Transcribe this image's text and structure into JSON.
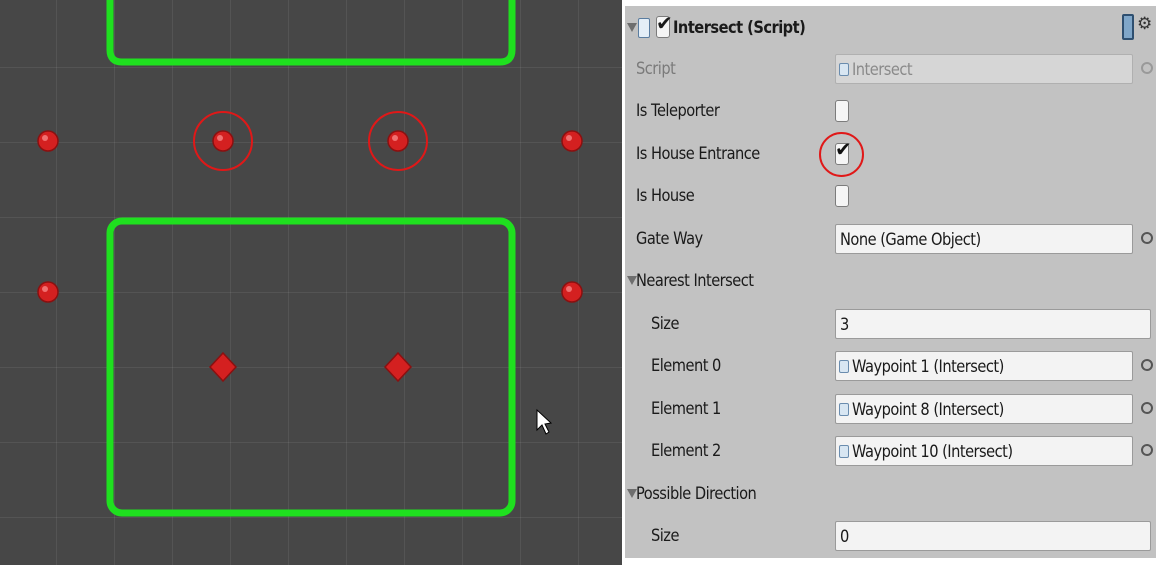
{
  "component": {
    "title": "Intersect (Script)",
    "enabled": true
  },
  "fields": {
    "script_label": "Script",
    "script_value": "Intersect",
    "is_teleporter_label": "Is Teleporter",
    "is_teleporter_checked": false,
    "is_house_entrance_label": "Is House Entrance",
    "is_house_entrance_checked": true,
    "is_house_label": "Is House",
    "is_house_checked": false,
    "gate_way_label": "Gate Way",
    "gate_way_value": "None (Game Object)"
  },
  "nearest_intersect": {
    "label": "Nearest Intersect",
    "size_label": "Size",
    "size_value": "3",
    "elements": [
      {
        "label": "Element 0",
        "value": "Waypoint 1 (Intersect)"
      },
      {
        "label": "Element 1",
        "value": "Waypoint 8 (Intersect)"
      },
      {
        "label": "Element 2",
        "value": "Waypoint 10 (Intersect)"
      }
    ]
  },
  "possible_direction": {
    "label": "Possible Direction",
    "size_label": "Size",
    "size_value": "0"
  },
  "colors": {
    "scene_background": "#474747",
    "boundary_green": "#1fe01f",
    "waypoint_red": "#d42020",
    "highlight_red": "#e01818",
    "inspector_background": "#c2c2c2"
  },
  "icons": [
    "script-icon",
    "checkbox-checkmark-icon",
    "help-book-icon",
    "gear-icon",
    "object-picker-icon",
    "foldout-arrow-icon",
    "mouse-cursor-icon"
  ]
}
